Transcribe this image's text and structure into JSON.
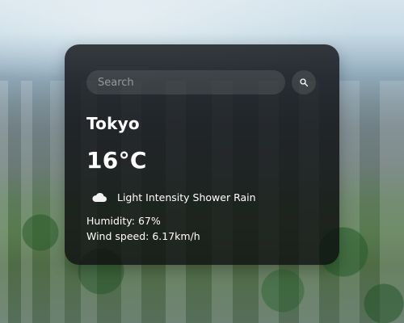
{
  "search": {
    "placeholder": "Search",
    "value": ""
  },
  "weather": {
    "city": "Tokyo",
    "temperature": "16°C",
    "condition": "Light Intensity Shower Rain",
    "condition_icon": "cloud-icon",
    "humidity": "Humidity: 67%",
    "wind": "Wind speed: 6.17km/h"
  },
  "icons": {
    "search": "search-icon"
  },
  "colors": {
    "card_bg": "#0a0c0e",
    "text": "#ffffff"
  }
}
